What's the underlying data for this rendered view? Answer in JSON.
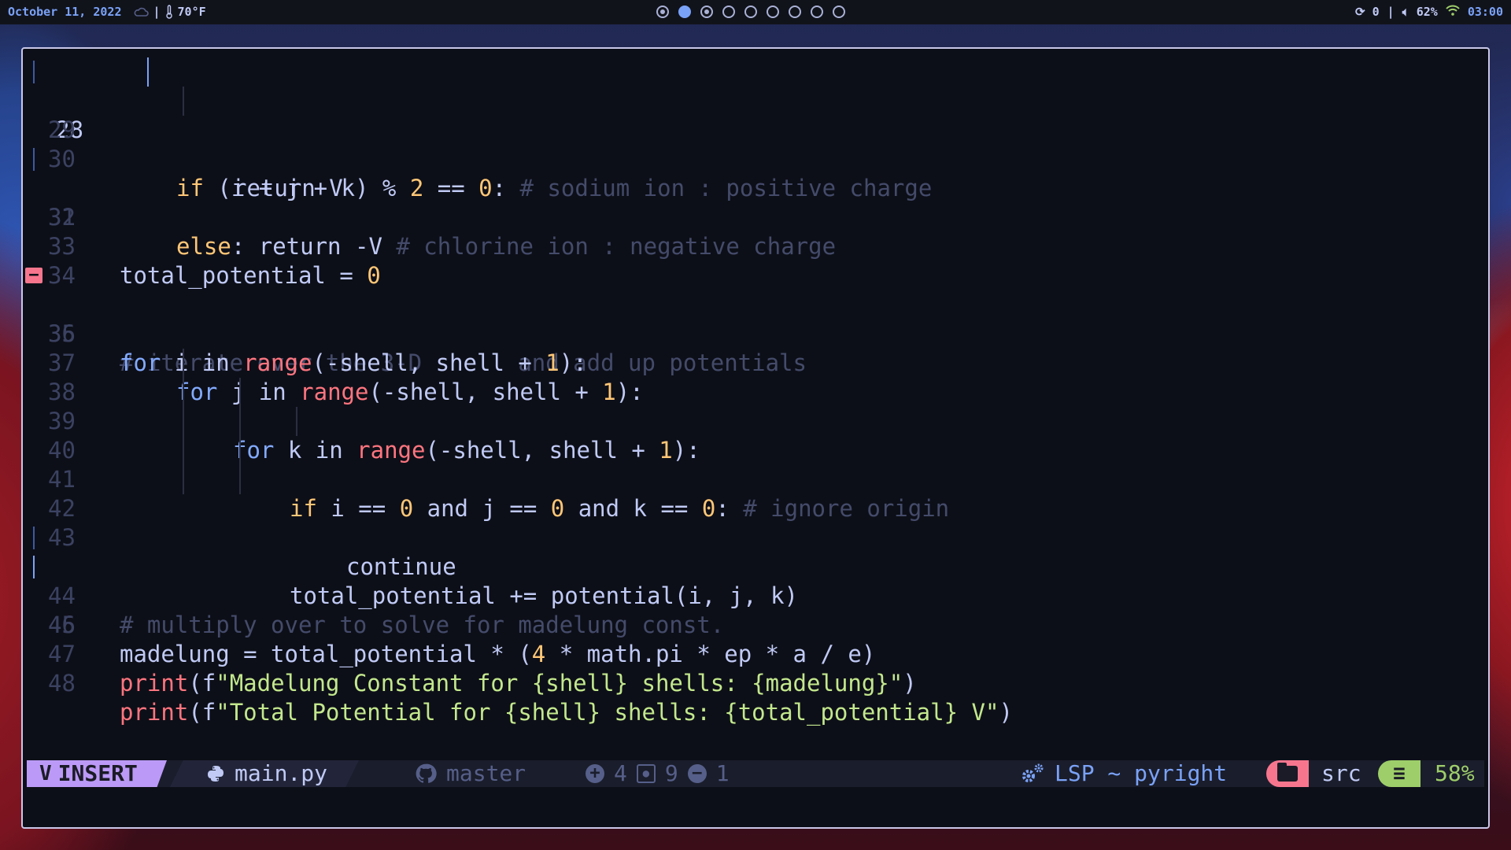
{
  "topbar": {
    "date": "October 11, 2022",
    "weather_icon": "cloud-icon",
    "thermometer_icon": "thermometer-icon",
    "temperature": "70°F",
    "workspaces": [
      {
        "state": "dot"
      },
      {
        "state": "active"
      },
      {
        "state": "dot"
      },
      {
        "state": "empty"
      },
      {
        "state": "empty"
      },
      {
        "state": "empty"
      },
      {
        "state": "empty"
      },
      {
        "state": "empty"
      },
      {
        "state": "empty"
      }
    ],
    "updates": "0",
    "volume": "62%",
    "clock": "03:00"
  },
  "editor": {
    "current_line": "28",
    "lines": [
      {
        "n": "28"
      },
      {
        "n": "29"
      },
      {
        "n": "30"
      },
      {
        "n": "31"
      },
      {
        "n": "32"
      },
      {
        "n": "33"
      },
      {
        "n": "34"
      },
      {
        "n": "35"
      },
      {
        "n": "36"
      },
      {
        "n": "37"
      },
      {
        "n": "38"
      },
      {
        "n": "39"
      },
      {
        "n": "40"
      },
      {
        "n": "41"
      },
      {
        "n": "42"
      },
      {
        "n": "43"
      },
      {
        "n": "44"
      },
      {
        "n": "45"
      },
      {
        "n": "46"
      },
      {
        "n": "47"
      },
      {
        "n": "48"
      }
    ],
    "code": {
      "l28_if": "if",
      "l28_expr": " (i + j + k) % ",
      "l28_two": "2",
      "l28_eq": " == ",
      "l28_zero": "0",
      "l28_colon": ": ",
      "l28_comment": "# sodium ion : positive charge",
      "l29": "return V",
      "l31_else": "else",
      "l31_rest": ": return -V ",
      "l31_comment": "# chlorine ion : negative charge",
      "l33_lhs": "total_potential = ",
      "l33_zero": "0",
      "l35_comment": "# iterate over the 3-D shell and add up potentials",
      "for": "for",
      "range": "range",
      "l36_var": " i in ",
      "l37_var": " j in ",
      "l38_var": " k in ",
      "range_args": "(-shell, shell + ",
      "one": "1",
      "range_end": "):",
      "l39_if": "if",
      "l39_a": " i == ",
      "l39_b": " and j == ",
      "l39_c": " and k == ",
      "zero": "0",
      "l39_colon": ": ",
      "l39_comment": "# ignore origin",
      "l40": "continue",
      "l42": "total_potential += potential(i, j, k)",
      "l44_comment": "# multiply over to solve for madelung const.",
      "l45_a": "madelung = total_potential * (",
      "l45_four": "4",
      "l45_b": " * math.pi * ep * a / e)",
      "print": "print",
      "l47_open": "(f",
      "l47_str": "\"Madelung Constant for {shell} shells: {madelung}\"",
      "close_paren": ")",
      "l48_str": "\"Total Potential for {shell} shells: {total_potential} V\""
    }
  },
  "statusline": {
    "mode": "INSERT",
    "file_icon": "python-icon",
    "file": "main.py",
    "branch_icon": "github-icon",
    "branch": "master",
    "added": "4",
    "changed": "9",
    "removed": "1",
    "lsp_icon": "gears-icon",
    "lsp": "LSP ~ pyright",
    "folder_icon": "folder-icon",
    "dir": "src",
    "progress_icon": "lines-icon",
    "percent": "58%"
  },
  "colors": {
    "accent": "#7aa2f7",
    "mode_bg": "#bb9af7",
    "keyword": "#ffc777",
    "function": "#ff757f",
    "string": "#c3e88d",
    "comment": "#444b6a"
  }
}
